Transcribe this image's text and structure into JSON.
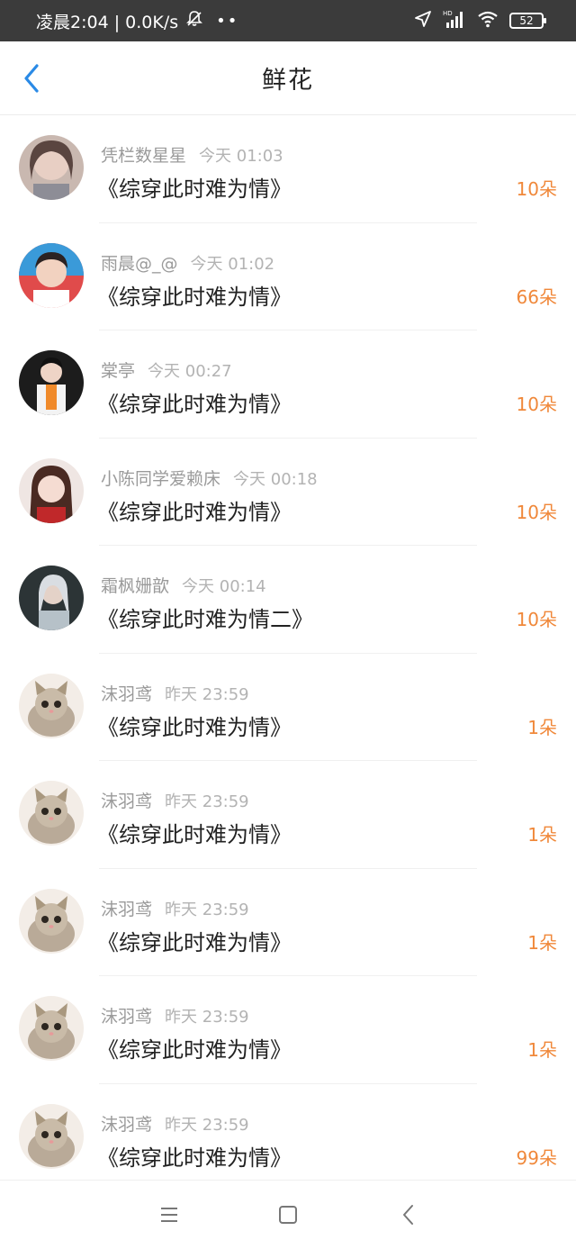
{
  "status_bar": {
    "time_text": "凌晨2:04 | 0.0K/s",
    "dots": "••",
    "battery": "52",
    "icons": [
      "bell-off-icon",
      "location-arrow-icon",
      "hd-signal-icon",
      "wifi-icon",
      "battery-icon"
    ]
  },
  "header": {
    "title": "鲜花",
    "back_icon": "chevron-left-icon",
    "accent_color": "#2a8ae6"
  },
  "list": {
    "count_color": "#f0883a",
    "items": [
      {
        "user": "凭栏数星星",
        "time": "今天 01:03",
        "book": "《综穿此时难为情》",
        "count": "10朵",
        "avatar": "girl-photo"
      },
      {
        "user": "雨晨@_@",
        "time": "今天 01:02",
        "book": "《综穿此时难为情》",
        "count": "66朵",
        "avatar": "smiling-man-photo"
      },
      {
        "user": "棠亭",
        "time": "今天 00:27",
        "book": "《综穿此时难为情》",
        "count": "10朵",
        "avatar": "man-orange-shirt-photo"
      },
      {
        "user": "小陈同学爱赖床",
        "time": "今天 00:18",
        "book": "《综穿此时难为情》",
        "count": "10朵",
        "avatar": "illustrated-girl"
      },
      {
        "user": "霜枫姗歆",
        "time": "今天 00:14",
        "book": "《综穿此时难为情二》",
        "count": "10朵",
        "avatar": "silver-hair-costume-photo"
      },
      {
        "user": "沫羽鸢",
        "time": "昨天 23:59",
        "book": "《综穿此时难为情》",
        "count": "1朵",
        "avatar": "kitten-photo"
      },
      {
        "user": "沫羽鸢",
        "time": "昨天 23:59",
        "book": "《综穿此时难为情》",
        "count": "1朵",
        "avatar": "kitten-photo"
      },
      {
        "user": "沫羽鸢",
        "time": "昨天 23:59",
        "book": "《综穿此时难为情》",
        "count": "1朵",
        "avatar": "kitten-photo"
      },
      {
        "user": "沫羽鸢",
        "time": "昨天 23:59",
        "book": "《综穿此时难为情》",
        "count": "1朵",
        "avatar": "kitten-photo"
      },
      {
        "user": "沫羽鸢",
        "time": "昨天 23:59",
        "book": "《综穿此时难为情》",
        "count": "99朵",
        "avatar": "kitten-photo"
      }
    ]
  },
  "nav_bar": {
    "buttons": [
      "menu-icon",
      "home-square-icon",
      "back-triangle-icon"
    ]
  }
}
